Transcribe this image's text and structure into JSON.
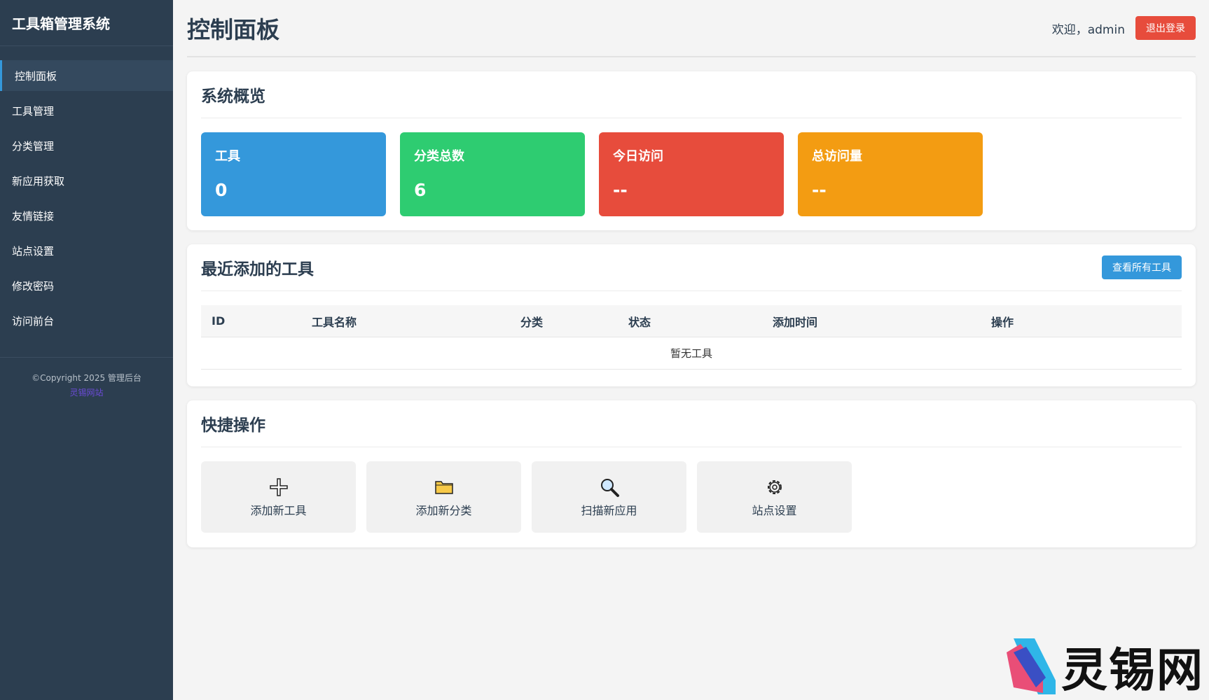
{
  "sidebar": {
    "brand": "工具箱管理系统",
    "items": [
      {
        "label": "控制面板"
      },
      {
        "label": "工具管理"
      },
      {
        "label": "分类管理"
      },
      {
        "label": "新应用获取"
      },
      {
        "label": "友情链接"
      },
      {
        "label": "站点设置"
      },
      {
        "label": "修改密码"
      },
      {
        "label": "访问前台"
      }
    ],
    "footer": {
      "copyright": "©Copyright 2025 管理后台",
      "link": "灵锡网站"
    }
  },
  "header": {
    "title": "控制面板",
    "welcome": "欢迎，admin",
    "logout_label": "退出登录"
  },
  "overview": {
    "title": "系统概览",
    "stats": [
      {
        "label": "工具",
        "value": "0",
        "color": "#3498db"
      },
      {
        "label": "分类总数",
        "value": "6",
        "color": "#2ecc71"
      },
      {
        "label": "今日访问",
        "value": "--",
        "color": "#e74c3c"
      },
      {
        "label": "总访问量",
        "value": "--",
        "color": "#f39c12"
      }
    ]
  },
  "recent": {
    "title": "最近添加的工具",
    "view_all_label": "查看所有工具",
    "columns": [
      "ID",
      "工具名称",
      "分类",
      "状态",
      "添加时间",
      "操作"
    ],
    "empty_text": "暂无工具"
  },
  "quick": {
    "title": "快捷操作",
    "actions": [
      {
        "label": "添加新工具",
        "icon": "plus-icon"
      },
      {
        "label": "添加新分类",
        "icon": "folder-icon"
      },
      {
        "label": "扫描新应用",
        "icon": "magnifier-icon"
      },
      {
        "label": "站点设置",
        "icon": "gear-icon"
      }
    ]
  },
  "watermark": {
    "text": "灵锡网"
  }
}
